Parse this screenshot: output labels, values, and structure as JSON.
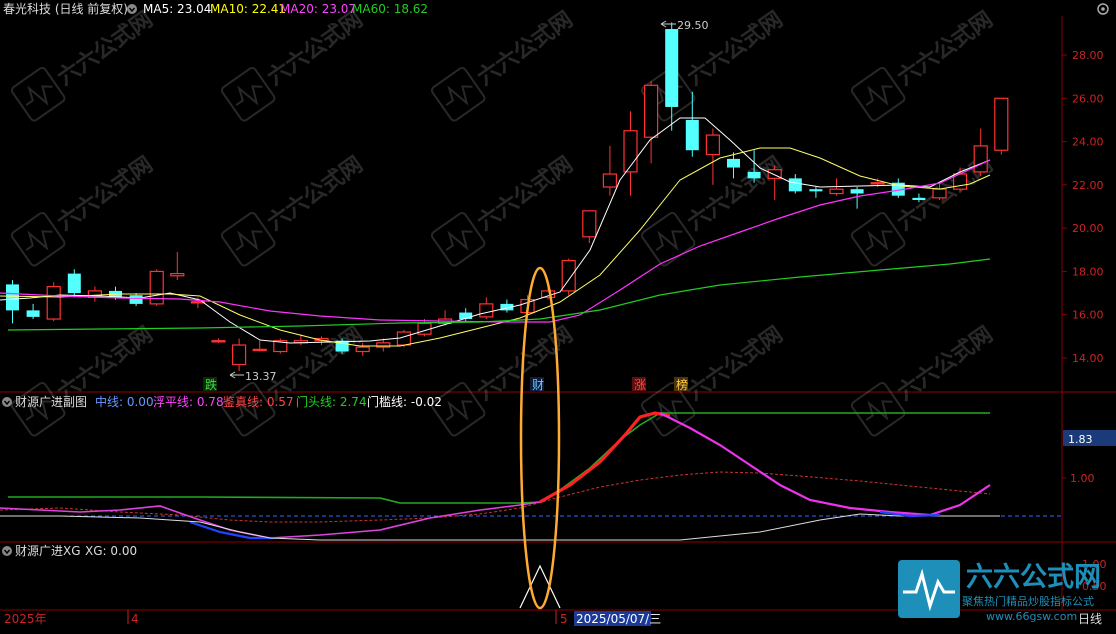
{
  "header": {
    "stock_title": "春光科技 (日线 前复权)",
    "ma": [
      {
        "label": "MA5: 23.04",
        "color": "#ffffff"
      },
      {
        "label": "MA10: 22.41",
        "color": "#ffff00"
      },
      {
        "label": "MA20: 23.07",
        "color": "#ff44ff"
      },
      {
        "label": "MA60: 18.62",
        "color": "#22cc22"
      }
    ],
    "settings_icon": "gear-icon",
    "dropdown_icon": "chevron-down-icon"
  },
  "main_panel": {
    "price_axis": {
      "ticks": [
        "28.00",
        "26.00",
        "24.00",
        "22.00",
        "20.00",
        "18.00",
        "16.00",
        "14.00"
      ]
    },
    "annotations": {
      "high": "29.50",
      "low": "13.37"
    },
    "signals": [
      {
        "text": "跌",
        "color": "#44dd44"
      },
      {
        "text": "财",
        "color": "#66ccff"
      },
      {
        "text": "涨",
        "color": "#ff4444"
      },
      {
        "text": "榜",
        "color": "#ffcc44"
      }
    ]
  },
  "sub_panel": {
    "title": "财源广进副图",
    "items": [
      {
        "label": "中线: 0.00",
        "color": "#6699ff"
      },
      {
        "label": "浮平线: 0.78",
        "color": "#ff44ff"
      },
      {
        "label": "鉴真线: 0.57",
        "color": "#ff4444"
      },
      {
        "label": "门头线: 2.74",
        "color": "#22cc22"
      },
      {
        "label": "门槛线: -0.02",
        "color": "#ffffff"
      }
    ],
    "axis_ticks": [
      "1.83",
      "1.00"
    ]
  },
  "xg_panel": {
    "title": "财源广进XG",
    "value_label": "XG: 0.00",
    "axis_ticks": [
      "1.00",
      "0.50"
    ]
  },
  "time_axis": {
    "labels": [
      "2025年",
      "4",
      "5",
      "2025/05/07/三"
    ],
    "period": "日线"
  },
  "watermark": {
    "brand": "六六公式网",
    "tagline": "聚焦热门精品炒股指标公式",
    "url": "www.66gsw.com"
  },
  "colors": {
    "up": "#ff3232",
    "down": "#54ffff",
    "grid": "#8b0000",
    "highlight": "#ffaa33"
  }
}
